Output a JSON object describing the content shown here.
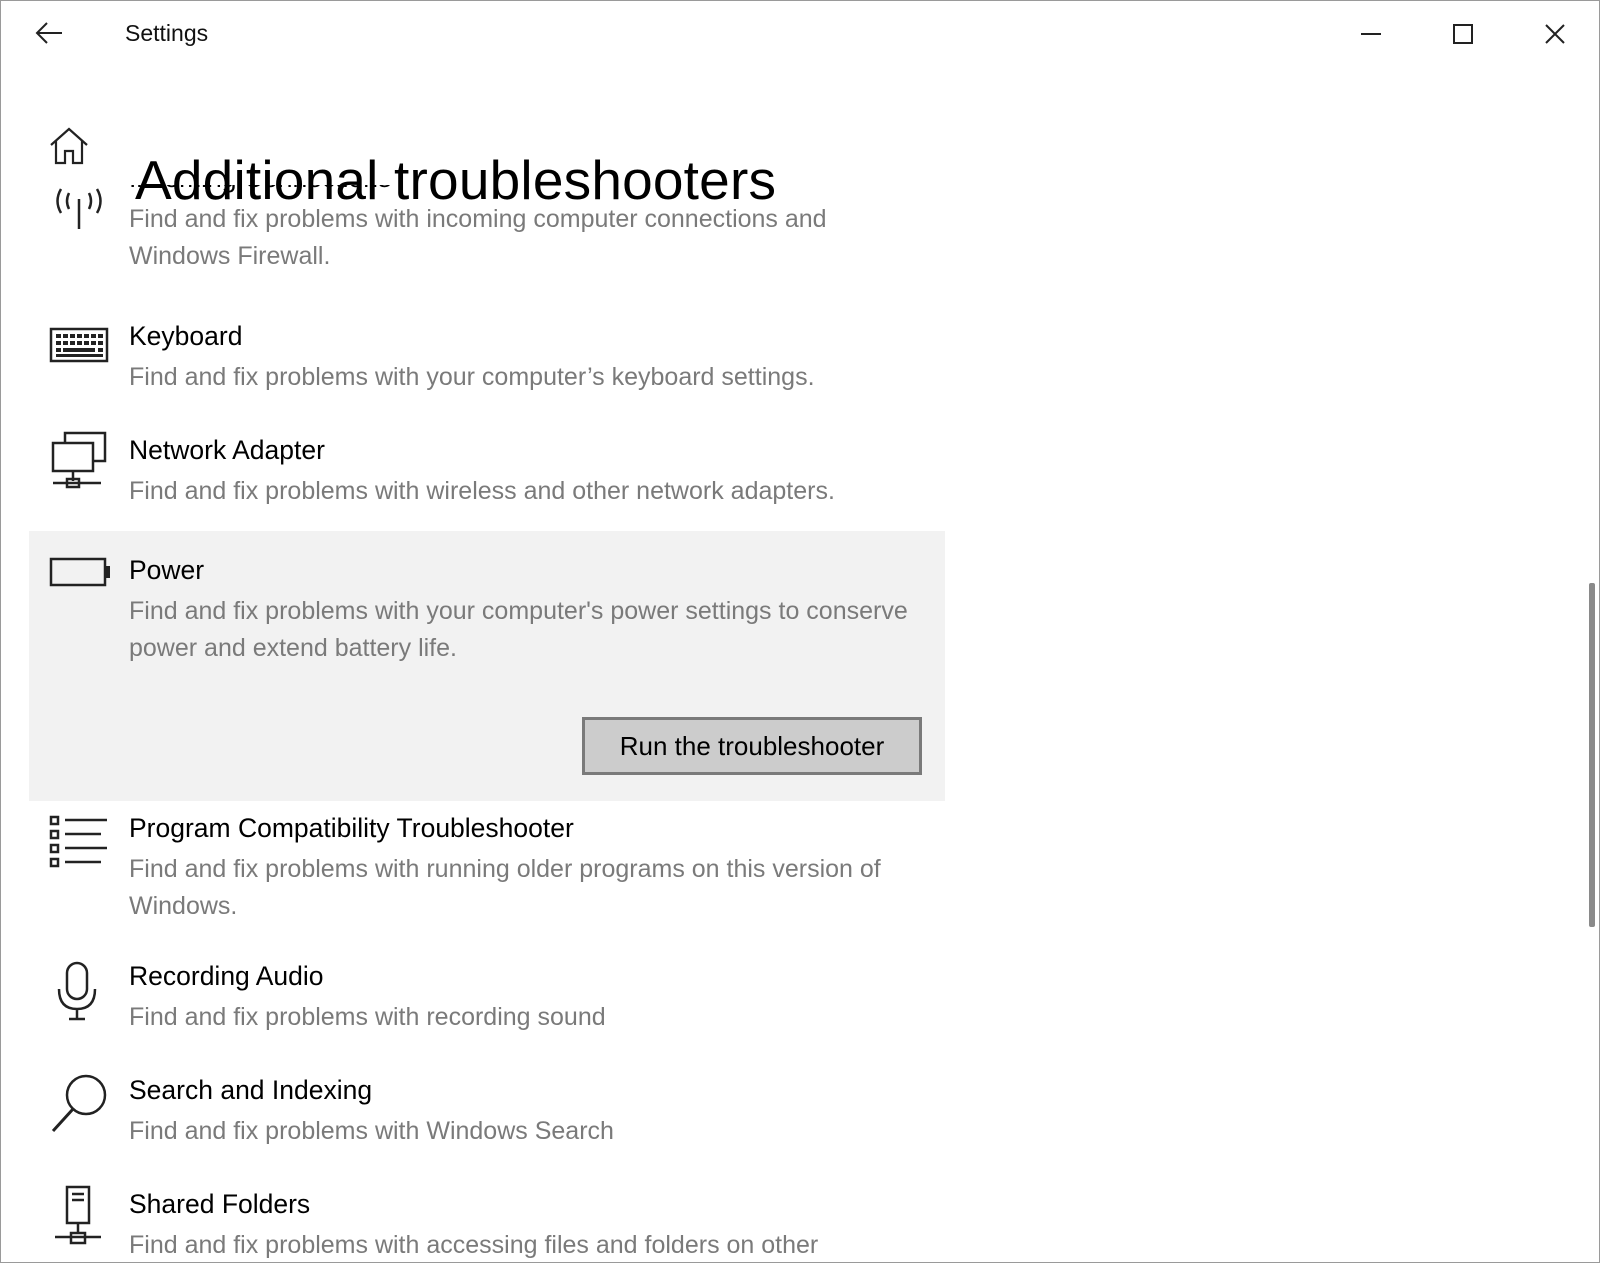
{
  "window": {
    "title": "Settings",
    "controls": {
      "minimize": "minimize-icon",
      "maximize": "maximize-icon",
      "close": "close-icon"
    }
  },
  "header": {
    "title": "Additional troubleshooters"
  },
  "items": [
    {
      "name": "Incoming Connections",
      "description": "Find and fix problems with incoming computer connections and Windows Firewall.",
      "icon": "antenna-icon"
    },
    {
      "name": "Keyboard",
      "description": "Find and fix problems with your computer’s keyboard settings.",
      "icon": "keyboard-icon"
    },
    {
      "name": "Network Adapter",
      "description": "Find and fix problems with wireless and other network adapters.",
      "icon": "network-adapter-icon"
    },
    {
      "name": "Power",
      "description": "Find and fix problems with your computer's power settings to conserve power and extend battery life.",
      "icon": "battery-icon",
      "selected": true,
      "button": "Run the troubleshooter"
    },
    {
      "name": "Program Compatibility Troubleshooter",
      "description": "Find and fix problems with running older programs on this version of Windows.",
      "icon": "list-icon"
    },
    {
      "name": "Recording Audio",
      "description": "Find and fix problems with recording sound",
      "icon": "microphone-icon"
    },
    {
      "name": "Search and Indexing",
      "description": "Find and fix problems with Windows Search",
      "icon": "search-icon"
    },
    {
      "name": "Shared Folders",
      "description": "Find and fix problems with accessing files and folders on other computers.",
      "icon": "shared-folders-icon"
    }
  ],
  "colors": {
    "selected_bg": "#f2f2f2",
    "description_text": "#7a7a7a",
    "button_bg": "#cccccc",
    "button_border": "#7a7a7a"
  }
}
